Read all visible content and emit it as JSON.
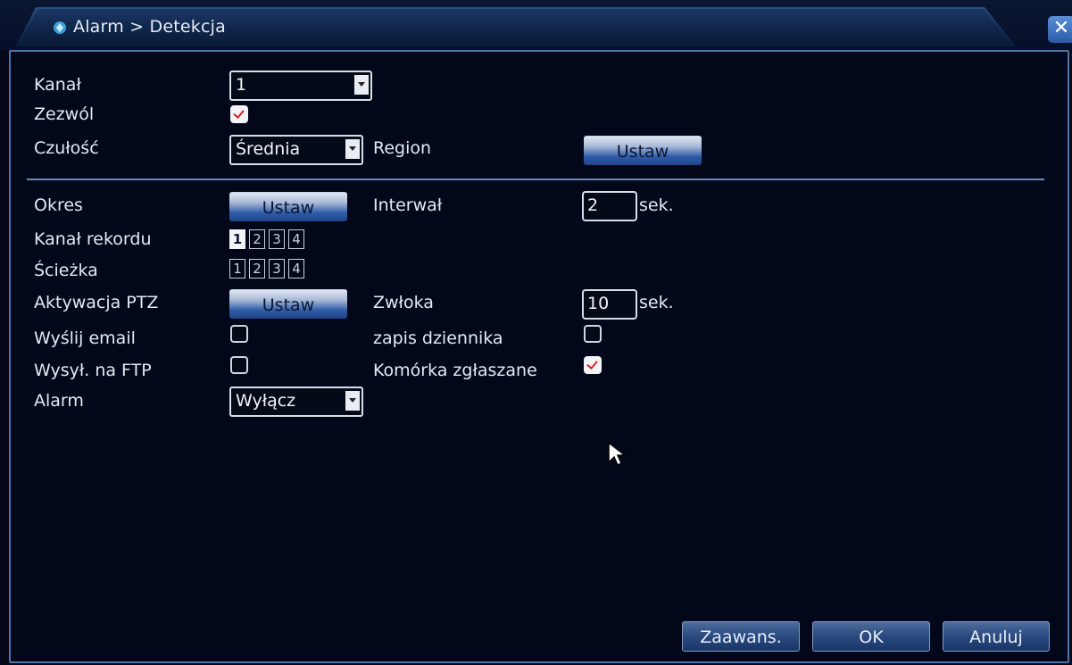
{
  "window": {
    "title": "Alarm > Detekcja",
    "close_icon": "close-icon"
  },
  "form": {
    "kanal": {
      "label": "Kanał",
      "value": "1"
    },
    "zezwol": {
      "label": "Zezwól",
      "checked": true
    },
    "czulosc": {
      "label": "Czułość",
      "value": "Średnia"
    },
    "region": {
      "label": "Region",
      "button": "Ustaw"
    },
    "okres": {
      "label": "Okres",
      "button": "Ustaw"
    },
    "interwal": {
      "label": "Interwał",
      "value": "2",
      "unit": "sek."
    },
    "kanal_rekordu": {
      "label": "Kanał rekordu",
      "channels": [
        "1",
        "2",
        "3",
        "4"
      ],
      "selected": [
        "1"
      ]
    },
    "sciezka": {
      "label": "Ścieżka",
      "channels": [
        "1",
        "2",
        "3",
        "4"
      ],
      "selected": []
    },
    "aktywacja_ptz": {
      "label": "Aktywacja PTZ",
      "button": "Ustaw"
    },
    "zwloka": {
      "label": "Zwłoka",
      "value": "10",
      "unit": "sek."
    },
    "wyslij_email": {
      "label": "Wyślij email",
      "checked": false
    },
    "zapis_dziennika": {
      "label": "zapis dziennika",
      "checked": false
    },
    "wysyl_ftp": {
      "label": "Wysył. na FTP",
      "checked": false
    },
    "komorka": {
      "label": "Komórka zgłaszane",
      "checked": true
    },
    "alarm": {
      "label": "Alarm",
      "value": "Wyłącz"
    }
  },
  "footer": {
    "advanced": "Zaawans.",
    "ok": "OK",
    "cancel": "Anuluj"
  }
}
